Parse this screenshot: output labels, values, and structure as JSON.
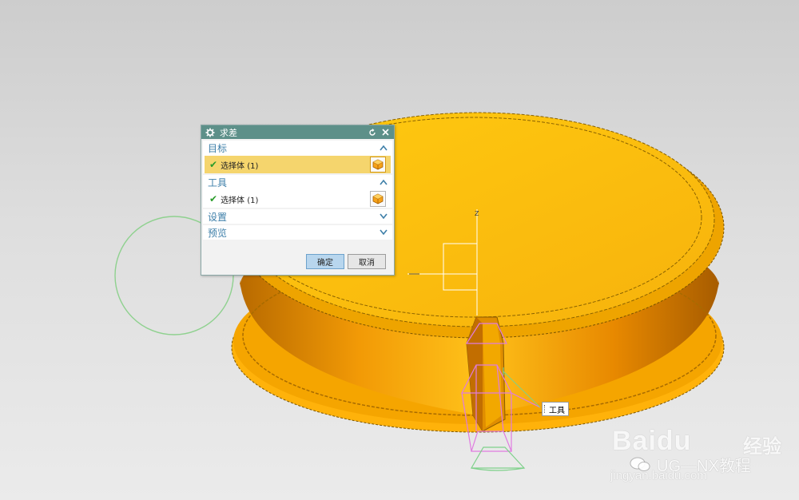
{
  "dialog": {
    "title": "求差",
    "target_group": {
      "label": "目标",
      "selection": "选择体 (1)"
    },
    "tool_group": {
      "label": "工具",
      "selection": "选择体 (1)"
    },
    "settings_label": "设置",
    "preview_label": "预览",
    "ok_label": "确定",
    "cancel_label": "取消"
  },
  "viewport": {
    "axis_label": "Z",
    "tool_tag": "工具",
    "part_color": "#f8b51b",
    "accent_green": "#7fd18b",
    "accent_pink": "#e07be0"
  },
  "watermark": {
    "brand": "Baidu",
    "brand_suffix": "经验",
    "channel": "UG—NX教程",
    "url": "jingyan.baidu.com"
  },
  "icons": {
    "dialog_settings": "gear-icon",
    "reset": "reset-icon",
    "close": "close-icon",
    "expand": "chevron-down-icon",
    "collapse": "chevron-up-icon",
    "select_body": "cube-icon",
    "check": "check-icon"
  }
}
